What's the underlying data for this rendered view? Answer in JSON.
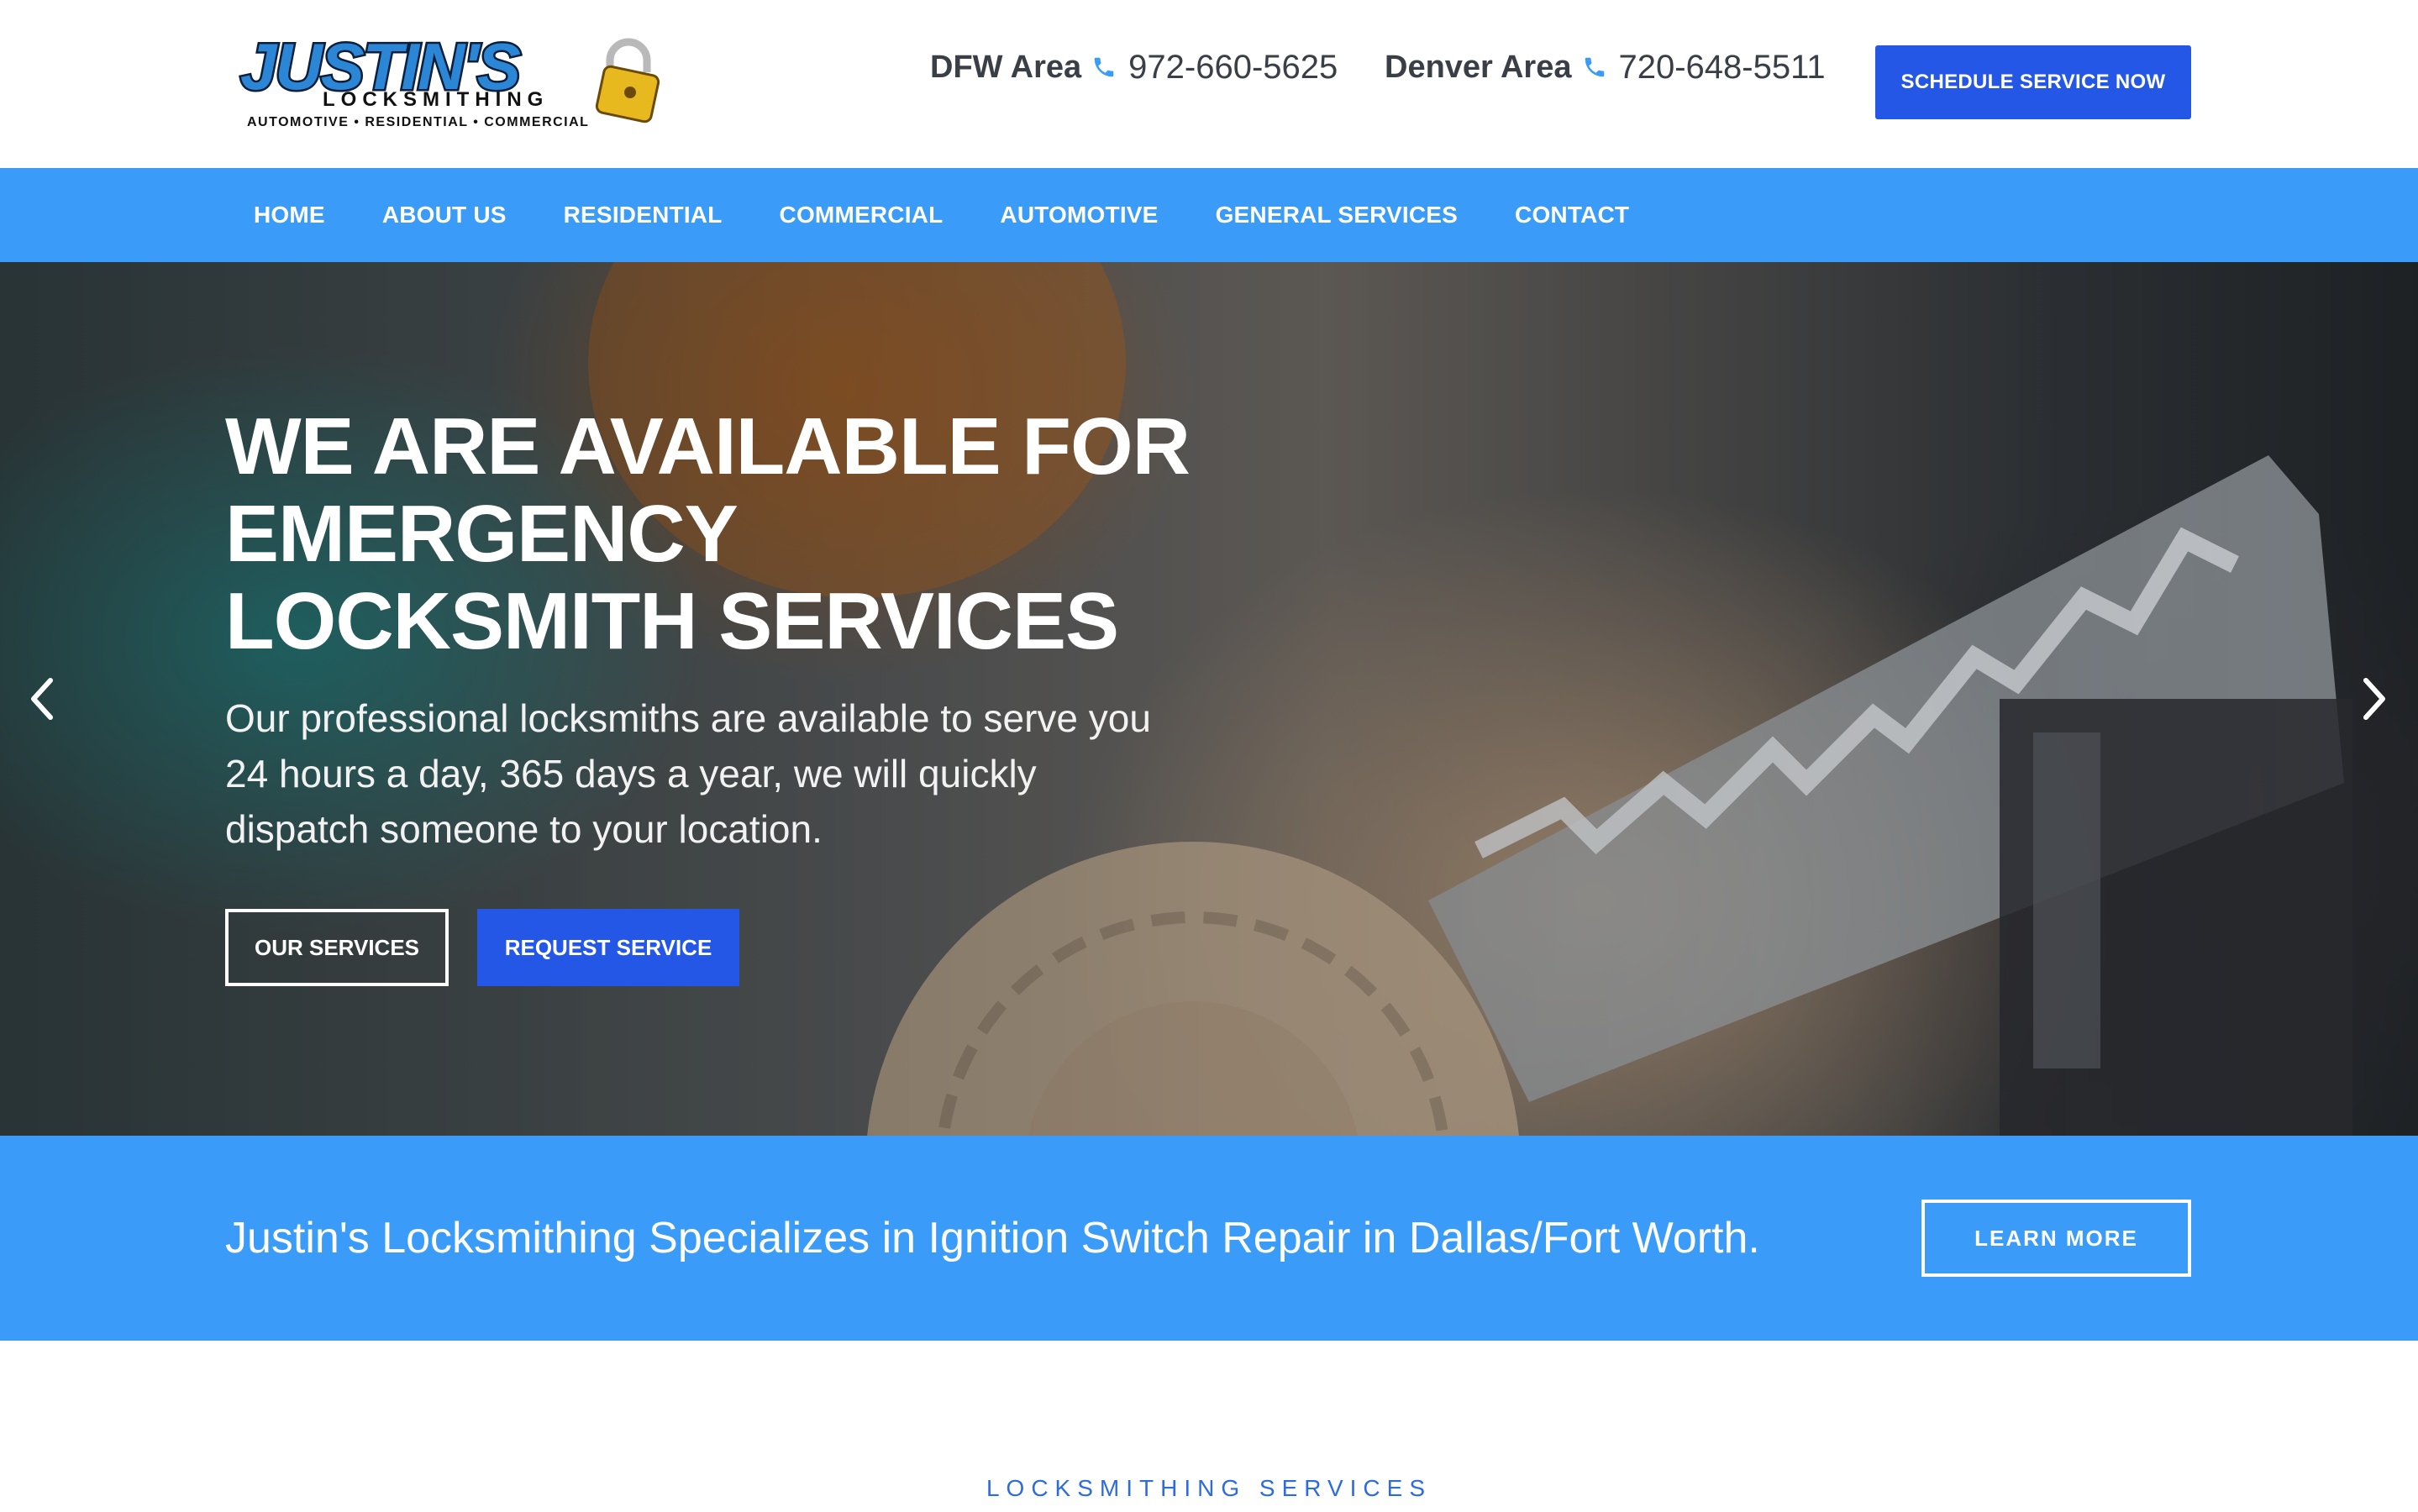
{
  "brand": {
    "logo_word": "JUSTIN'S",
    "logo_sub": "LOCKSMITHING",
    "logo_tagline": "AUTOMOTIVE • RESIDENTIAL • COMMERCIAL",
    "colors": {
      "primary_blue": "#2557e6",
      "nav_blue": "#3a9cf8",
      "text_dark": "#3a3f47"
    }
  },
  "header": {
    "phones": [
      {
        "area": "DFW Area",
        "icon": "phone-icon",
        "number": "972-660-5625"
      },
      {
        "area": "Denver Area",
        "icon": "phone-icon",
        "number": "720-648-5511"
      }
    ],
    "cta_label": "SCHEDULE SERVICE NOW"
  },
  "nav": {
    "items": [
      {
        "label": "HOME"
      },
      {
        "label": "ABOUT US"
      },
      {
        "label": "RESIDENTIAL"
      },
      {
        "label": "COMMERCIAL"
      },
      {
        "label": "AUTOMOTIVE"
      },
      {
        "label": "GENERAL SERVICES"
      },
      {
        "label": "CONTACT"
      }
    ]
  },
  "hero": {
    "title_lines": [
      "WE ARE AVAILABLE FOR",
      "EMERGENCY",
      "LOCKSMITH SERVICES"
    ],
    "subtitle": "Our professional locksmiths are available to serve you 24 hours a day, 365 days a year, we will quickly dispatch someone to your location.",
    "primary_button": "OUR SERVICES",
    "secondary_button": "REQUEST SERVICE",
    "prev_icon": "chevron-left-icon",
    "next_icon": "chevron-right-icon"
  },
  "promo": {
    "text": "Justin's Locksmithing Specializes in Ignition Switch Repair in Dallas/Fort Worth.",
    "button": "LEARN MORE"
  },
  "services": {
    "label": "LOCKSMITHING SERVICES"
  }
}
